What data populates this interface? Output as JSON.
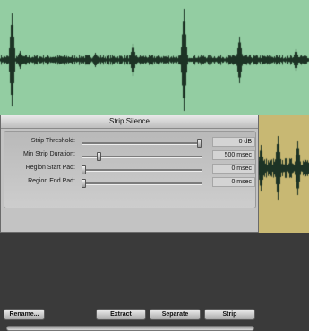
{
  "dialog": {
    "title": "Strip Silence",
    "params": [
      {
        "label": "Strip Threshold:",
        "value": "0 dB",
        "level": 1.0
      },
      {
        "label": "Min Strip Duration:",
        "value": "500 msec",
        "level": 0.13
      },
      {
        "label": "Region Start Pad:",
        "value": "0 msec",
        "level": 0.0
      },
      {
        "label": "Region End Pad:",
        "value": "0 msec",
        "level": 0.0
      }
    ],
    "buttons": {
      "rename": "Rename...",
      "extract": "Extract",
      "separate": "Separate",
      "strip": "Strip"
    }
  },
  "colors": {
    "waveform_bg_top": "#93cda2",
    "waveform_bg_bottom": "#c8b873",
    "waveform": "#1d3325"
  }
}
